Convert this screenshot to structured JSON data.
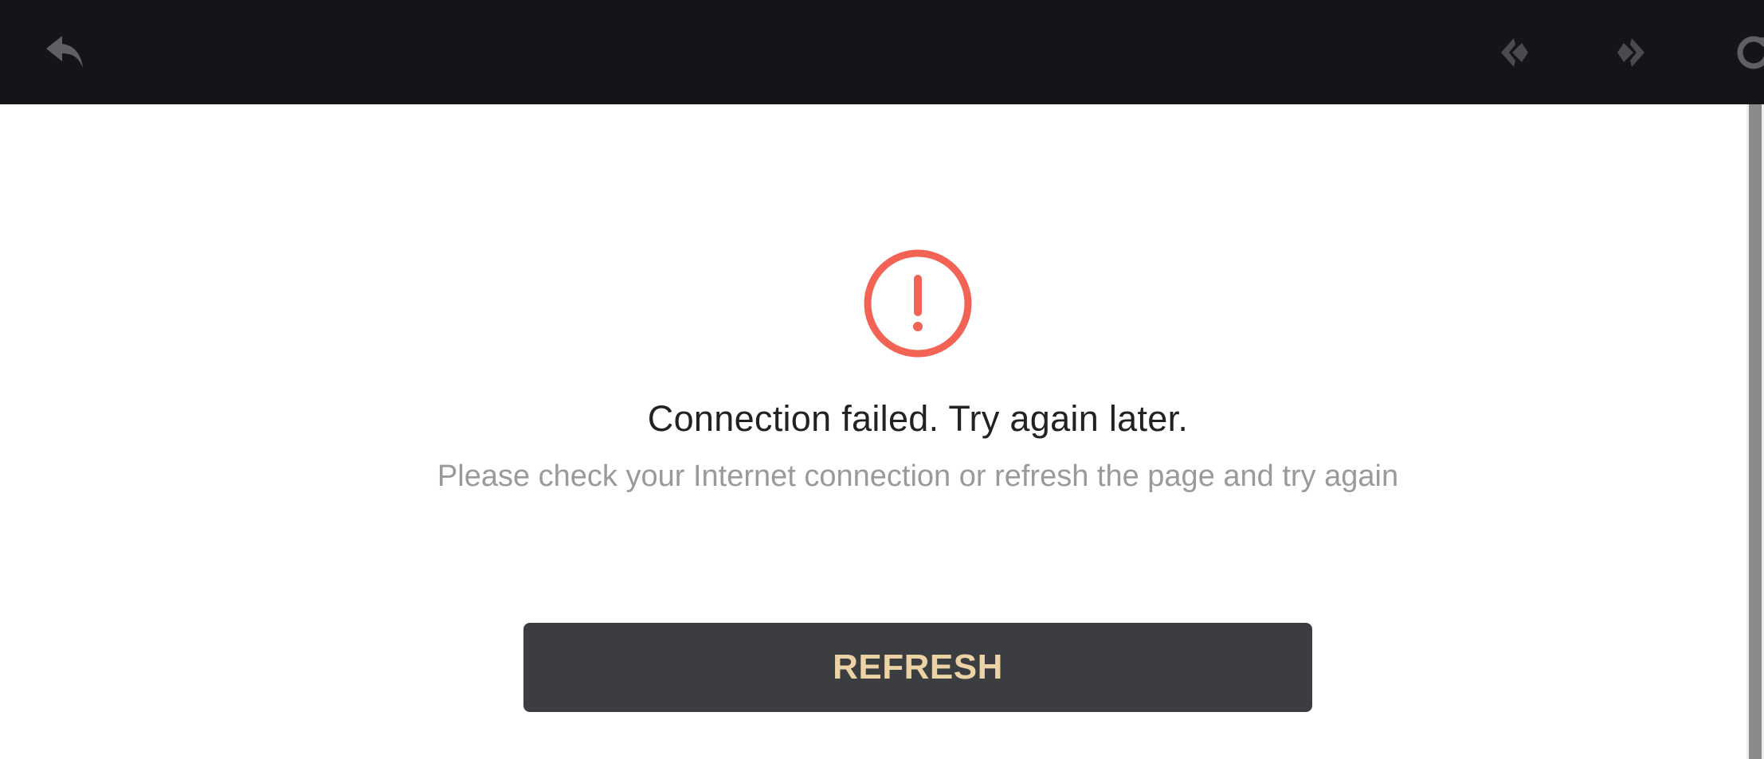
{
  "toolbar": {
    "icons": {
      "back": "back-arrow-icon",
      "previous": "previous-icon",
      "next": "next-icon",
      "reload": "reload-icon"
    },
    "background": "#141518",
    "icon_color": "#5f6064"
  },
  "error": {
    "icon": "error-exclamation-icon",
    "icon_color": "#f26355",
    "title": "Connection failed. Try again later.",
    "subtitle": "Please check your Internet connection or refresh the page and try again"
  },
  "actions": {
    "refresh_label": "REFRESH",
    "refresh_bg": "#3c3d41",
    "refresh_text_color": "#ecd3a6"
  }
}
